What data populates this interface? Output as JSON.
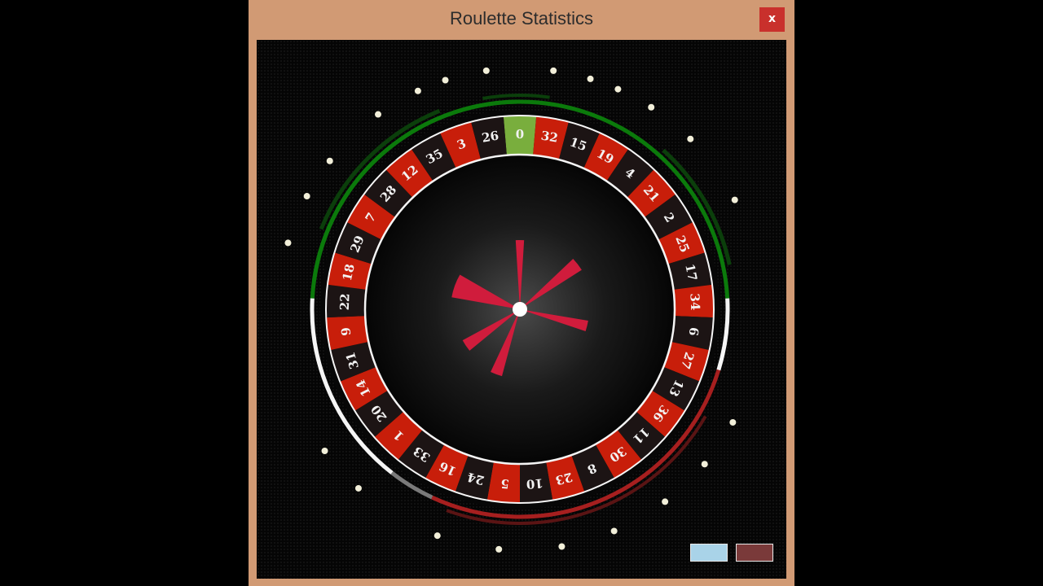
{
  "window": {
    "title": "Roulette Statistics",
    "close_label": "x"
  },
  "wheel": {
    "numbers": [
      0,
      32,
      15,
      19,
      4,
      21,
      2,
      25,
      17,
      34,
      6,
      27,
      13,
      36,
      11,
      30,
      8,
      23,
      10,
      5,
      24,
      16,
      33,
      1,
      20,
      14,
      31,
      9,
      22,
      18,
      29,
      7,
      28,
      12,
      35,
      3,
      26
    ],
    "colors": {
      "red_pocket": "#c81e0a",
      "black_pocket": "#1c1414",
      "green_pocket": "#79ae3d",
      "pocket_text": "#f2f2f2",
      "ring_line": "#f5f5f5",
      "stat_green": "#0b7a0b",
      "stat_green_dark": "#0b3f0b",
      "stat_white": "#f5f5f5",
      "stat_red": "#a61f1f",
      "stat_red_dark": "#5a1414",
      "stat_grey": "#7a7a7a",
      "rose_petal": "#d01c3c",
      "dot": "#f2efd9"
    }
  },
  "legend": {
    "blue_color": "#a9d3e8",
    "red_color": "#7a3a3a"
  }
}
